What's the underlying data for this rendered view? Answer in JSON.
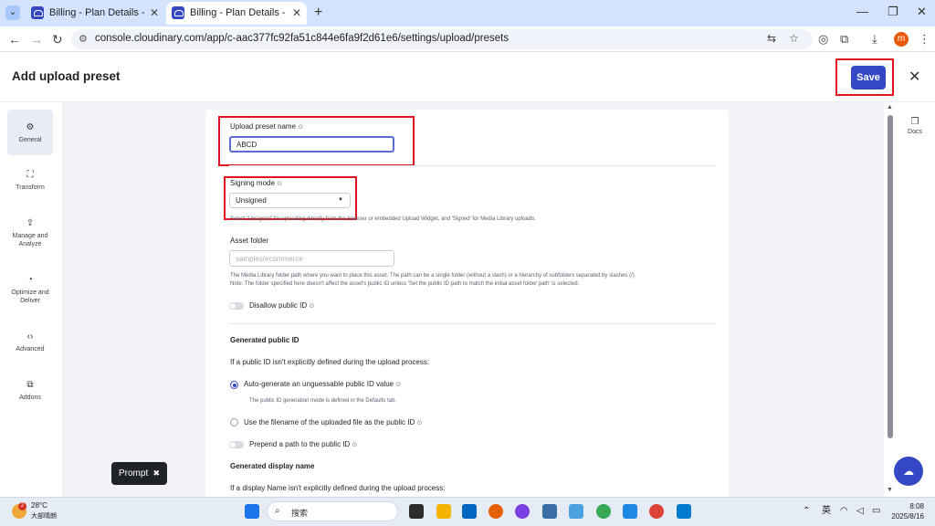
{
  "browser": {
    "tabs": [
      {
        "title": "Billing - Plan Details - Cloudi",
        "active": false
      },
      {
        "title": "Billing - Plan Details - Cloudi",
        "active": true
      }
    ],
    "url": "console.cloudinary.com/app/c-aac377fc92fa51c844e6fa9f2d61e6/settings/upload/presets",
    "profile_initial": "m"
  },
  "header": {
    "title": "Add upload preset",
    "save_label": "Save"
  },
  "leftnav": {
    "items": [
      {
        "label": "General",
        "icon": "gear-icon"
      },
      {
        "label": "Transform",
        "icon": "crop-icon"
      },
      {
        "label": "Manage and Analyze",
        "icon": "upload-icon"
      },
      {
        "label": "Optimize and Deliver",
        "icon": "gauge-icon"
      },
      {
        "label": "Advanced",
        "icon": "code-icon"
      },
      {
        "label": "Addons",
        "icon": "puzzle-icon"
      }
    ]
  },
  "form": {
    "preset_name_label": "Upload preset name",
    "preset_name_value": "ABCD",
    "signing_mode_label": "Signing mode",
    "signing_mode_value": "Unsigned",
    "signing_mode_help": "Select 'Unsigned' for uploading directly from the browser or embedded Upload Widget, and 'Signed' for Media Library uploads.",
    "asset_folder_label": "Asset folder",
    "asset_folder_placeholder": "samples/ecommerce",
    "asset_folder_help_1": "The Media Library folder path where you want to place this asset. The path can be a single folder (without a slash) or a hierarchy of subfolders separated by slashes (/).",
    "asset_folder_help_2": "Note: The folder specified here doesn't affect the asset's public ID unless 'Set the public ID path to match the initial asset folder path' is selected.",
    "disallow_public_id_label": "Disallow public ID",
    "generated_public_id_title": "Generated public ID",
    "public_id_intro": "If a public ID isn't explicitly defined during the upload process:",
    "radio_auto_label": "Auto-generate an unguessable public ID value",
    "radio_auto_help": "The public ID generation mode is defined in the Defaults tab.",
    "radio_filename_label": "Use the filename of the uploaded file as the public ID",
    "prepend_path_label": "Prepend a path to the public ID",
    "generated_display_name_title": "Generated display name",
    "display_name_intro": "If a display Name isn't explicitly defined during the upload process:"
  },
  "side": {
    "docs_label": "Docs"
  },
  "prompt": {
    "label": "Prompt"
  },
  "taskbar": {
    "weather_badge": "2",
    "temperature": "28°C",
    "condition": "大部晴朗",
    "search_placeholder": "搜索",
    "ime": "英",
    "time": "8:08",
    "date": "2025/8/16"
  }
}
